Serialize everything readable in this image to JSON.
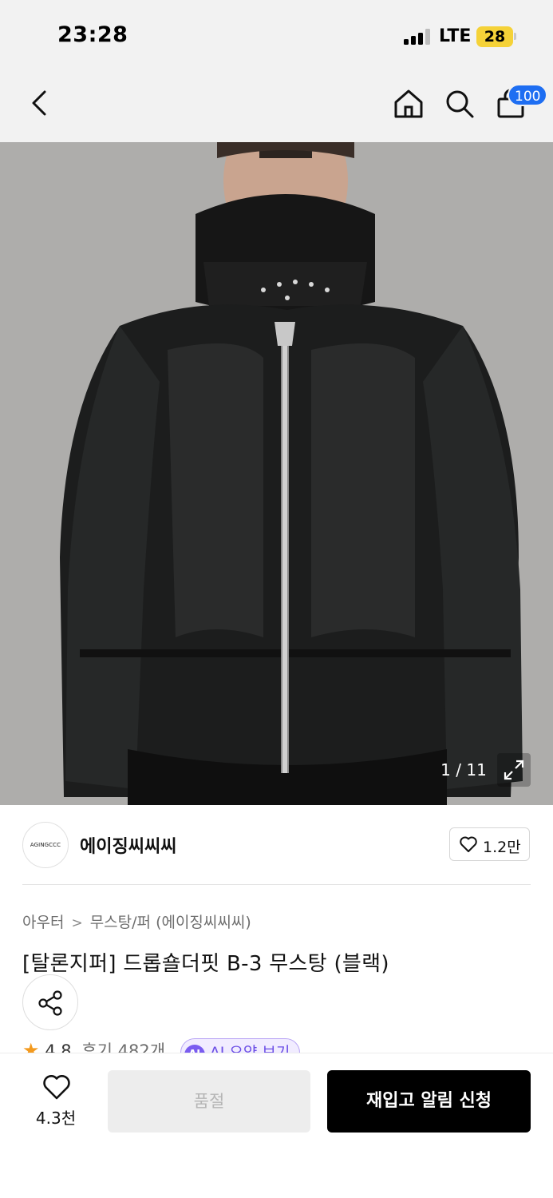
{
  "status_bar": {
    "time": "23:28",
    "network": "LTE",
    "battery": "28"
  },
  "header": {
    "cart_count": "100"
  },
  "gallery": {
    "counter": "1 / 11",
    "image_alt": "Black leather B-3 mustang jacket"
  },
  "brand": {
    "logo_text": "AGINGCCC",
    "name": "에이징씨씨씨",
    "like_count": "1.2만"
  },
  "breadcrumb": {
    "category": "아우터",
    "separator": ">",
    "subcategory": "무스탕/퍼 (에이징씨씨씨)"
  },
  "product": {
    "title": "[탈론지퍼] 드롭숄더핏 B-3 무스탕 (블랙)"
  },
  "rating": {
    "star": "★",
    "score": "4.8",
    "reviews": "후기 482개",
    "ai_badge": "AI",
    "ai_summary": "AI 요약 보기"
  },
  "bottom_bar": {
    "wish_count": "4.3천",
    "soldout_label": "품절",
    "restock_label": "재입고 알림 신청"
  },
  "colors": {
    "accent_blue": "#1e6ef2",
    "ai_purple": "#7a5cf0",
    "star_orange": "#f39a1e"
  }
}
